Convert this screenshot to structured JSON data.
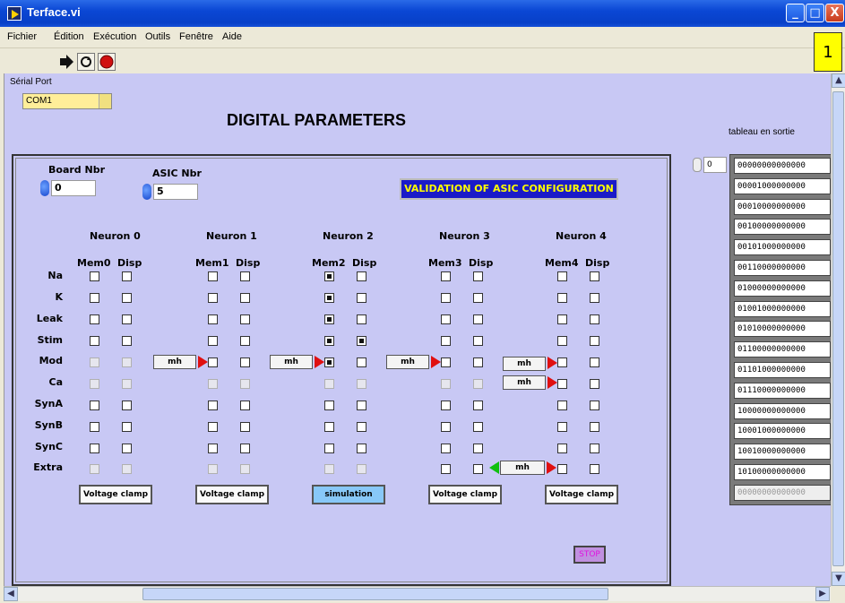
{
  "window": {
    "title": "Terface.vi",
    "minimize": "_",
    "maximize": "□",
    "close": "X"
  },
  "menu": [
    "Fichier",
    "Édition",
    "Exécution",
    "Outils",
    "Fenêtre",
    "Aide"
  ],
  "page_indicator": "1",
  "serial": {
    "label": "Sérial Port",
    "value": "COM1"
  },
  "panel_title": "DIGITAL PARAMETERS",
  "board": {
    "label": "Board Nbr",
    "value": "0"
  },
  "asic": {
    "label": "ASIC Nbr",
    "value": "5"
  },
  "validation_button": "VALIDATION OF ASIC CONFIGURATION",
  "neurons": [
    {
      "title": "Neuron 0",
      "mem": "Mem0",
      "disp": "Disp",
      "button": "Voltage clamp"
    },
    {
      "title": "Neuron 1",
      "mem": "Mem1",
      "disp": "Disp",
      "button": "Voltage clamp"
    },
    {
      "title": "Neuron 2",
      "mem": "Mem2",
      "disp": "Disp",
      "button": "simulation"
    },
    {
      "title": "Neuron 3",
      "mem": "Mem3",
      "disp": "Disp",
      "button": "Voltage clamp"
    },
    {
      "title": "Neuron 4",
      "mem": "Mem4",
      "disp": "Disp",
      "button": "Voltage clamp"
    }
  ],
  "rows": [
    "Na",
    "K",
    "Leak",
    "Stim",
    "Mod",
    "Ca",
    "SynA",
    "SynB",
    "SynC",
    "Extra"
  ],
  "checked": {
    "mem": [
      [
        2,
        0
      ],
      [
        2,
        1
      ],
      [
        2,
        2
      ],
      [
        2,
        3
      ],
      [
        2,
        4
      ]
    ],
    "disp": [
      [
        2,
        3
      ]
    ]
  },
  "mh_label": "mh",
  "stop_button": "STOP",
  "output": {
    "label": "tableau en sortie",
    "index": "0",
    "values": [
      "00000000000000",
      "00001000000000",
      "00010000000000",
      "00100000000000",
      "00101000000000",
      "00110000000000",
      "01000000000000",
      "01001000000000",
      "01010000000000",
      "01100000000000",
      "01101000000000",
      "01110000000000",
      "10000000000000",
      "10001000000000",
      "10010000000000",
      "10100000000000",
      "00000000000000"
    ]
  }
}
